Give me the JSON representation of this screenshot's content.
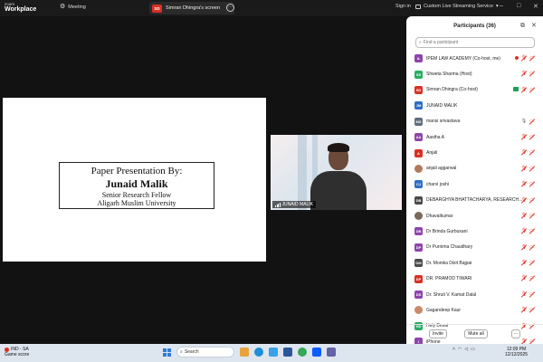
{
  "titlebar": {
    "logo_line1": "zoom",
    "logo_line2": "Workplace",
    "meeting_tab": "Meeting",
    "share_badge": "SD",
    "share_tab": "Simran Dhingra's screen",
    "sign_in": "Sign in",
    "streaming": "Custom Live Streaming Service",
    "minimize": "–",
    "maximize": "□",
    "close": "✕"
  },
  "slide": {
    "line1": "Paper Presentation By:",
    "line2": "Junaid Malik",
    "line3": "Senior Research Fellow",
    "line4": "Aligarh Muslim University"
  },
  "video": {
    "name": "JUNAID MALIK"
  },
  "participants_panel": {
    "title": "Participants (36)",
    "search_placeholder": "Find a participant",
    "invite": "Invite",
    "mute_all": "Mute all",
    "more": "···",
    "items": [
      {
        "initials": "IL",
        "name": "IPEM LAW ACADEMY (Co-host, me)",
        "color": "#8e44ad",
        "rec": true,
        "mic": "off",
        "cam": "off"
      },
      {
        "initials": "SS",
        "name": "Shweta Sharma (Host)",
        "color": "#27ae60",
        "mic": "off",
        "cam": "off"
      },
      {
        "initials": "SD",
        "name": "Simran Dhingra (Co-host)",
        "color": "#d93025",
        "share": true,
        "mic": "off",
        "cam": "off"
      },
      {
        "initials": "JM",
        "name": "JUNAID MALIK",
        "color": "#2c6fc9",
        "mic": "on",
        "cam": "on"
      },
      {
        "initials": "MS",
        "name": "mansi srivastava",
        "color": "#5d6d7e",
        "mic": "on-gray",
        "cam": "off"
      },
      {
        "initials": "AA",
        "name": "Aastha A",
        "color": "#8e44ad",
        "mic": "off",
        "cam": "off"
      },
      {
        "initials": "A",
        "name": "Anjali",
        "color": "#d93025",
        "mic": "off",
        "cam": "off"
      },
      {
        "initials": "",
        "name": "anjali aggarwal",
        "color": "#b07a5a",
        "photo": true,
        "mic": "off",
        "cam": "off"
      },
      {
        "initials": "CJ",
        "name": "charvi joshi",
        "color": "#2c6fc9",
        "mic": "off",
        "cam": "off"
      },
      {
        "initials": "DB",
        "name": "DEBARGHYA BHATTACHARYA, RESEARCH...",
        "color": "#4a4a4a",
        "mic": "off",
        "cam": "off"
      },
      {
        "initials": "",
        "name": "Dhavalkumar",
        "color": "#7a6a5a",
        "photo": true,
        "mic": "off",
        "cam": "off"
      },
      {
        "initials": "DB",
        "name": "Dr Brinda Gurbuxani",
        "color": "#8e44ad",
        "mic": "off",
        "cam": "off"
      },
      {
        "initials": "DP",
        "name": "Dr Purnima Chaudhary",
        "color": "#8e44ad",
        "mic": "off",
        "cam": "off"
      },
      {
        "initials": "DM",
        "name": "Dr. Monika Dixit Bajpai",
        "color": "#4a4a4a",
        "mic": "off",
        "cam": "off"
      },
      {
        "initials": "DP",
        "name": "DR. PRAMOD TIWARI",
        "color": "#d93025",
        "mic": "off",
        "cam": "off"
      },
      {
        "initials": "DS",
        "name": "Dr. Shruti V. Kamat Dalal",
        "color": "#8e44ad",
        "mic": "off",
        "cam": "off"
      },
      {
        "initials": "",
        "name": "Gagandeep Kaur",
        "color": "#c98a6a",
        "photo": true,
        "mic": "off",
        "cam": "off"
      },
      {
        "initials": "HD",
        "name": "Hely Desai",
        "color": "#27ae60",
        "mic": "off",
        "cam": "off"
      },
      {
        "initials": "I",
        "name": "iPhone",
        "color": "#8e44ad",
        "mic": "off",
        "cam": "off"
      }
    ]
  },
  "taskbar": {
    "weather_line1": "IND - SA",
    "weather_line2": "Game score",
    "search_placeholder": "Search",
    "time": "12:09 PM",
    "date": "12/12/2025"
  }
}
